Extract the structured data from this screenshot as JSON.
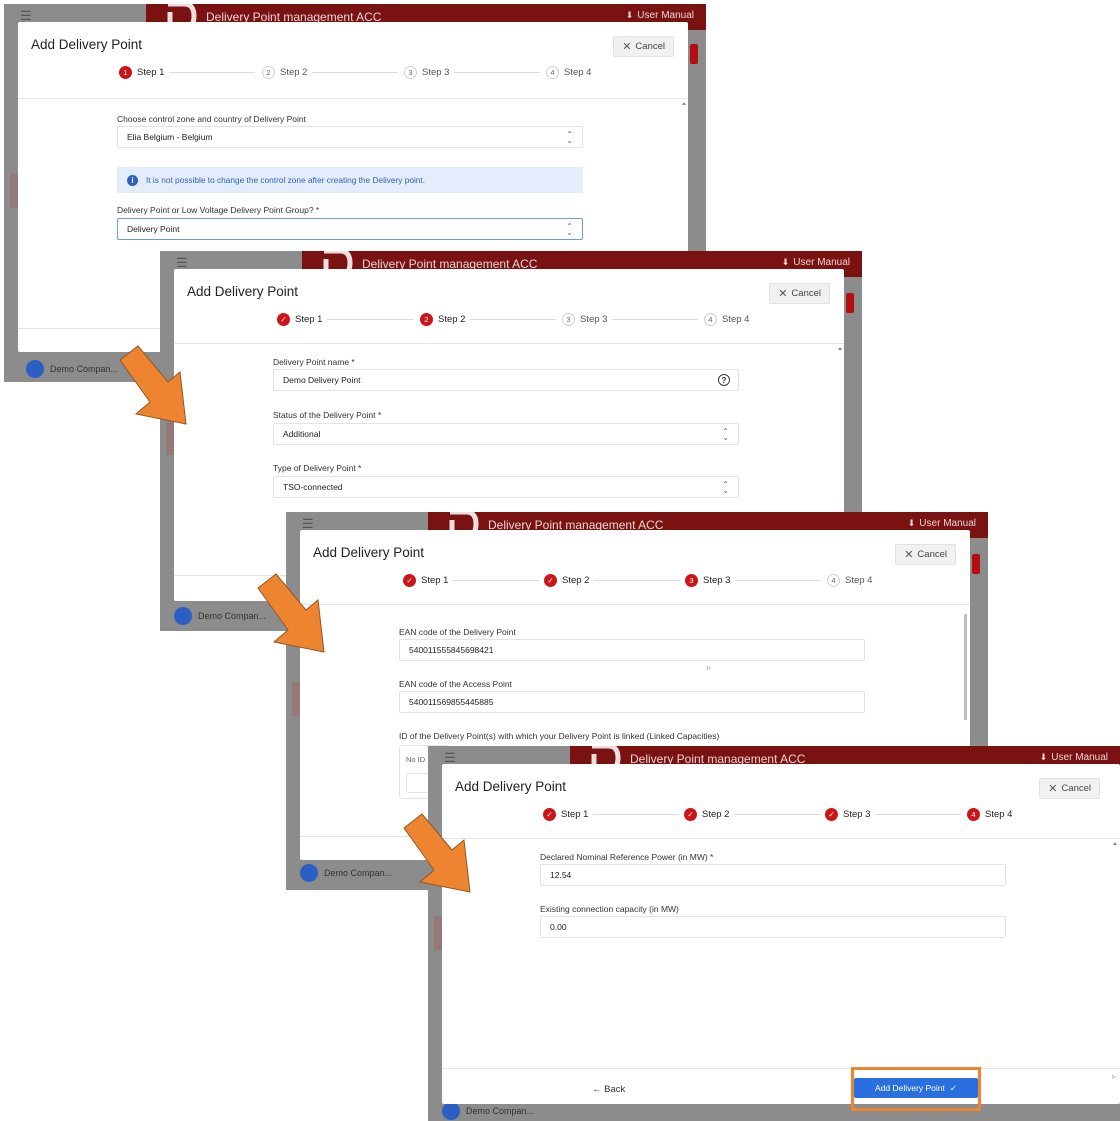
{
  "app": {
    "title": "Delivery Point management ACC",
    "user_manual": "User Manual",
    "user_name": "Demo Compan..."
  },
  "dialog": {
    "title": "Add Delivery Point",
    "cancel_label": "Cancel",
    "steps": [
      "Step 1",
      "Step 2",
      "Step 3",
      "Step 4"
    ],
    "step_numbers": [
      "1",
      "2",
      "3",
      "4"
    ]
  },
  "screen1": {
    "zone_label": "Choose control zone and country of Delivery Point",
    "zone_value": "Elia Belgium - Belgium",
    "info_text": "It is not possible to change the control zone after creating the Delivery point.",
    "type_label": "Delivery Point or Low Voltage Delivery Point Group? *",
    "type_value": "Delivery Point"
  },
  "screen2": {
    "name_label": "Delivery Point name *",
    "name_value": "Demo Delivery Point",
    "status_label": "Status of the Delivery Point *",
    "status_value": "Additional",
    "type_label": "Type of Delivery Point *",
    "type_value": "TSO-connected"
  },
  "screen3": {
    "ean_dp_label": "EAN code of the Delivery Point",
    "ean_dp_value": "540011555845698421",
    "ean_ap_label": "EAN code of the Access Point",
    "ean_ap_value": "540011569855445885",
    "linked_label": "ID of the Delivery Point(s) with which your Delivery Point is linked (Linked Capacities)",
    "no_id": "No ID"
  },
  "screen4": {
    "power_label": "Declared Nominal Reference Power (in MW) *",
    "power_value": "12.54",
    "capacity_label": "Existing connection capacity (in MW)",
    "capacity_value": "0.00",
    "back_label": "Back",
    "add_label": "Add Delivery Point"
  },
  "colors": {
    "brand_red": "#7b1212",
    "step_red": "#cc1518",
    "primary_blue": "#2a6fe0",
    "info_bg": "#e3edfb",
    "arrow_orange": "#ef8430"
  }
}
